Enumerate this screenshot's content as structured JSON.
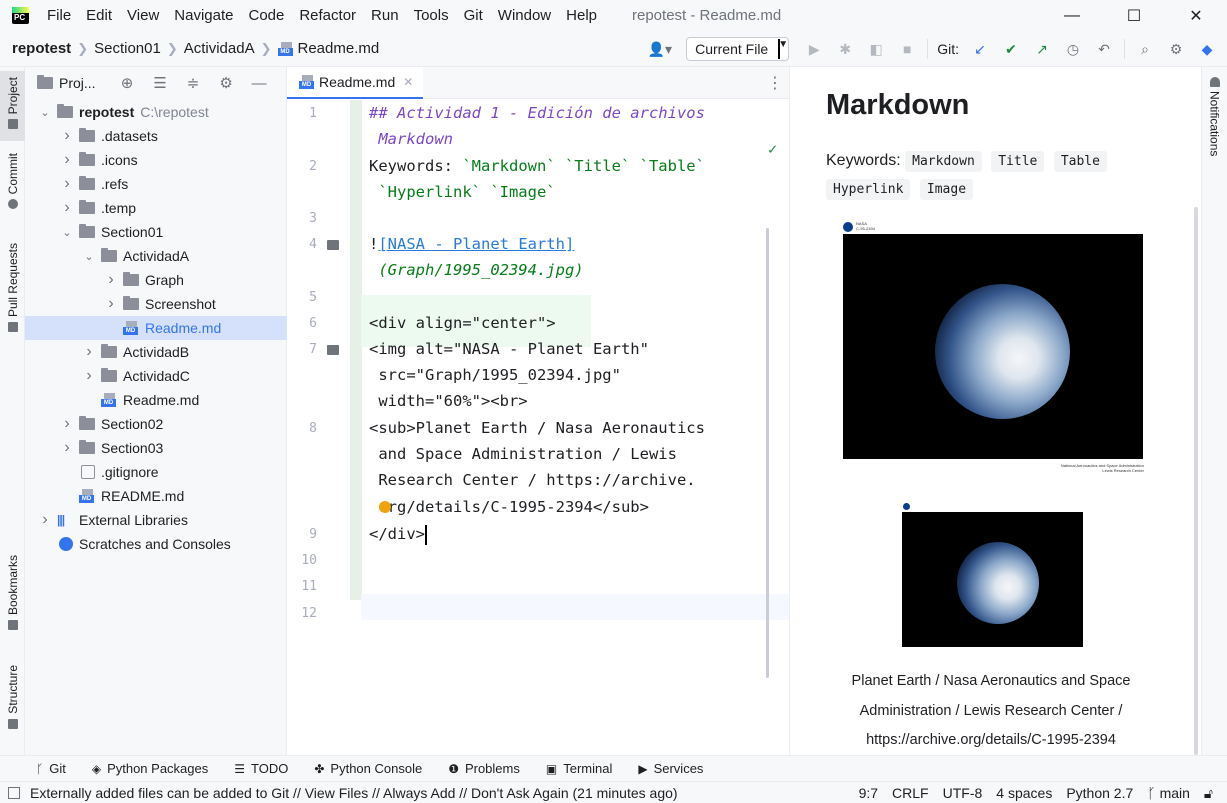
{
  "app": {
    "logo_text": "PC",
    "window_title": "repotest - Readme.md"
  },
  "menu": [
    "File",
    "Edit",
    "View",
    "Navigate",
    "Code",
    "Refactor",
    "Run",
    "Tools",
    "Git",
    "Window",
    "Help"
  ],
  "window_controls": {
    "minimize": "—",
    "maximize": "☐",
    "close": "✕"
  },
  "breadcrumb": {
    "root": "repotest",
    "items": [
      "Section01",
      "ActividadA"
    ],
    "file": "Readme.md"
  },
  "toolbar": {
    "run_config": "Current File",
    "git_label": "Git:"
  },
  "project_panel": {
    "title": "Proj...",
    "tree": [
      {
        "label": "repotest",
        "hint": "C:\\repotest",
        "level": 0,
        "expanded": true,
        "type": "folder",
        "bold": true
      },
      {
        "label": ".datasets",
        "level": 1,
        "expanded": false,
        "type": "folder"
      },
      {
        "label": ".icons",
        "level": 1,
        "expanded": false,
        "type": "folder"
      },
      {
        "label": ".refs",
        "level": 1,
        "expanded": false,
        "type": "folder"
      },
      {
        "label": ".temp",
        "level": 1,
        "expanded": false,
        "type": "folder"
      },
      {
        "label": "Section01",
        "level": 1,
        "expanded": true,
        "type": "folder"
      },
      {
        "label": "ActividadA",
        "level": 2,
        "expanded": true,
        "type": "folder"
      },
      {
        "label": "Graph",
        "level": 3,
        "expanded": false,
        "type": "folder"
      },
      {
        "label": "Screenshot",
        "level": 3,
        "expanded": false,
        "type": "folder"
      },
      {
        "label": "Readme.md",
        "level": 3,
        "type": "md",
        "selected": true
      },
      {
        "label": "ActividadB",
        "level": 2,
        "expanded": false,
        "type": "folder"
      },
      {
        "label": "ActividadC",
        "level": 2,
        "expanded": false,
        "type": "folder"
      },
      {
        "label": "Readme.md",
        "level": 2,
        "type": "md"
      },
      {
        "label": "Section02",
        "level": 1,
        "expanded": false,
        "type": "folder"
      },
      {
        "label": "Section03",
        "level": 1,
        "expanded": false,
        "type": "folder"
      },
      {
        "label": ".gitignore",
        "level": 1,
        "type": "gitignore"
      },
      {
        "label": "README.md",
        "level": 1,
        "type": "md"
      },
      {
        "label": "External Libraries",
        "level": 0,
        "expanded": false,
        "type": "libs"
      },
      {
        "label": "Scratches and Consoles",
        "level": 0,
        "type": "scratch"
      }
    ]
  },
  "left_strip": {
    "project": "Project",
    "commit": "Commit",
    "pull_requests": "Pull Requests",
    "bookmarks": "Bookmarks",
    "structure": "Structure"
  },
  "right_strip": {
    "notifications": "Notifications"
  },
  "editor": {
    "tab_label": "Readme.md",
    "line_numbers": [
      "1",
      "2",
      "3",
      "4",
      "5",
      "6",
      "7",
      "8",
      "9",
      "10",
      "11",
      "12"
    ],
    "lines": {
      "l1a": "## Actividad 1 - Edición de archivos",
      "l1b": " Markdown",
      "l2a_prefix": "Keywords: ",
      "l2a_codes": "`Markdown` `Title` `Table`",
      "l2b": " `Hyperlink` `Image`",
      "l4a_bang": "!",
      "l4a_link": "[NASA - Planet Earth]",
      "l4b": " (Graph/1995_02394.jpg)",
      "l6": "<div align=\"center\">",
      "l7a": "<img alt=\"NASA - Planet Earth\"",
      "l7b": " src=\"Graph/1995_02394.jpg\"",
      "l7c": " width=\"60%\"><br>",
      "l8a": "<sub>Planet Earth / Nasa Aeronautics",
      "l8b": " and Space Administration / Lewis",
      "l8c": " Research Center / https://archive.",
      "l8d": " org/details/C-1995-2394</sub>",
      "l9": "</div>"
    }
  },
  "preview": {
    "heading": "Markdown",
    "keywords_label": "Keywords:",
    "keywords": [
      "Markdown",
      "Title",
      "Table",
      "Hyperlink",
      "Image"
    ],
    "photo_header": "NASA",
    "photo_code": "C-95-2394",
    "photo_footer_1": "National Aeronautics and Space Administration",
    "photo_footer_2": "Lewis Research Center",
    "caption_1": "Planet Earth / Nasa Aeronautics and Space",
    "caption_2": "Administration / Lewis Research Center /",
    "caption_3": "https://archive.org/details/C-1995-2394"
  },
  "bottom_tools": [
    "Git",
    "Python Packages",
    "TODO",
    "Python Console",
    "Problems",
    "Terminal",
    "Services"
  ],
  "status": {
    "message": "Externally added files can be added to Git // View Files // Always Add // Don't Ask Again (21 minutes ago)",
    "position": "9:7",
    "line_sep": "CRLF",
    "encoding": "UTF-8",
    "indent": "4 spaces",
    "interpreter": "Python 2.7",
    "branch": "main"
  },
  "colors": {
    "accent": "#3574f0",
    "green": "#208a3c",
    "selection": "#d5e1fa"
  }
}
